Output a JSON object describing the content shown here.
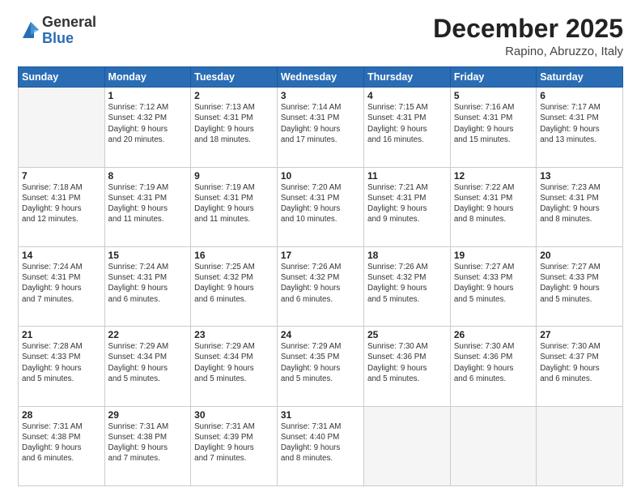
{
  "header": {
    "logo_general": "General",
    "logo_blue": "Blue",
    "month_title": "December 2025",
    "location": "Rapino, Abruzzo, Italy"
  },
  "weekdays": [
    "Sunday",
    "Monday",
    "Tuesday",
    "Wednesday",
    "Thursday",
    "Friday",
    "Saturday"
  ],
  "weeks": [
    [
      {
        "day": "",
        "info": ""
      },
      {
        "day": "1",
        "info": "Sunrise: 7:12 AM\nSunset: 4:32 PM\nDaylight: 9 hours\nand 20 minutes."
      },
      {
        "day": "2",
        "info": "Sunrise: 7:13 AM\nSunset: 4:31 PM\nDaylight: 9 hours\nand 18 minutes."
      },
      {
        "day": "3",
        "info": "Sunrise: 7:14 AM\nSunset: 4:31 PM\nDaylight: 9 hours\nand 17 minutes."
      },
      {
        "day": "4",
        "info": "Sunrise: 7:15 AM\nSunset: 4:31 PM\nDaylight: 9 hours\nand 16 minutes."
      },
      {
        "day": "5",
        "info": "Sunrise: 7:16 AM\nSunset: 4:31 PM\nDaylight: 9 hours\nand 15 minutes."
      },
      {
        "day": "6",
        "info": "Sunrise: 7:17 AM\nSunset: 4:31 PM\nDaylight: 9 hours\nand 13 minutes."
      }
    ],
    [
      {
        "day": "7",
        "info": "Sunrise: 7:18 AM\nSunset: 4:31 PM\nDaylight: 9 hours\nand 12 minutes."
      },
      {
        "day": "8",
        "info": "Sunrise: 7:19 AM\nSunset: 4:31 PM\nDaylight: 9 hours\nand 11 minutes."
      },
      {
        "day": "9",
        "info": "Sunrise: 7:19 AM\nSunset: 4:31 PM\nDaylight: 9 hours\nand 11 minutes."
      },
      {
        "day": "10",
        "info": "Sunrise: 7:20 AM\nSunset: 4:31 PM\nDaylight: 9 hours\nand 10 minutes."
      },
      {
        "day": "11",
        "info": "Sunrise: 7:21 AM\nSunset: 4:31 PM\nDaylight: 9 hours\nand 9 minutes."
      },
      {
        "day": "12",
        "info": "Sunrise: 7:22 AM\nSunset: 4:31 PM\nDaylight: 9 hours\nand 8 minutes."
      },
      {
        "day": "13",
        "info": "Sunrise: 7:23 AM\nSunset: 4:31 PM\nDaylight: 9 hours\nand 8 minutes."
      }
    ],
    [
      {
        "day": "14",
        "info": "Sunrise: 7:24 AM\nSunset: 4:31 PM\nDaylight: 9 hours\nand 7 minutes."
      },
      {
        "day": "15",
        "info": "Sunrise: 7:24 AM\nSunset: 4:31 PM\nDaylight: 9 hours\nand 6 minutes."
      },
      {
        "day": "16",
        "info": "Sunrise: 7:25 AM\nSunset: 4:32 PM\nDaylight: 9 hours\nand 6 minutes."
      },
      {
        "day": "17",
        "info": "Sunrise: 7:26 AM\nSunset: 4:32 PM\nDaylight: 9 hours\nand 6 minutes."
      },
      {
        "day": "18",
        "info": "Sunrise: 7:26 AM\nSunset: 4:32 PM\nDaylight: 9 hours\nand 5 minutes."
      },
      {
        "day": "19",
        "info": "Sunrise: 7:27 AM\nSunset: 4:33 PM\nDaylight: 9 hours\nand 5 minutes."
      },
      {
        "day": "20",
        "info": "Sunrise: 7:27 AM\nSunset: 4:33 PM\nDaylight: 9 hours\nand 5 minutes."
      }
    ],
    [
      {
        "day": "21",
        "info": "Sunrise: 7:28 AM\nSunset: 4:33 PM\nDaylight: 9 hours\nand 5 minutes."
      },
      {
        "day": "22",
        "info": "Sunrise: 7:29 AM\nSunset: 4:34 PM\nDaylight: 9 hours\nand 5 minutes."
      },
      {
        "day": "23",
        "info": "Sunrise: 7:29 AM\nSunset: 4:34 PM\nDaylight: 9 hours\nand 5 minutes."
      },
      {
        "day": "24",
        "info": "Sunrise: 7:29 AM\nSunset: 4:35 PM\nDaylight: 9 hours\nand 5 minutes."
      },
      {
        "day": "25",
        "info": "Sunrise: 7:30 AM\nSunset: 4:36 PM\nDaylight: 9 hours\nand 5 minutes."
      },
      {
        "day": "26",
        "info": "Sunrise: 7:30 AM\nSunset: 4:36 PM\nDaylight: 9 hours\nand 6 minutes."
      },
      {
        "day": "27",
        "info": "Sunrise: 7:30 AM\nSunset: 4:37 PM\nDaylight: 9 hours\nand 6 minutes."
      }
    ],
    [
      {
        "day": "28",
        "info": "Sunrise: 7:31 AM\nSunset: 4:38 PM\nDaylight: 9 hours\nand 6 minutes."
      },
      {
        "day": "29",
        "info": "Sunrise: 7:31 AM\nSunset: 4:38 PM\nDaylight: 9 hours\nand 7 minutes."
      },
      {
        "day": "30",
        "info": "Sunrise: 7:31 AM\nSunset: 4:39 PM\nDaylight: 9 hours\nand 7 minutes."
      },
      {
        "day": "31",
        "info": "Sunrise: 7:31 AM\nSunset: 4:40 PM\nDaylight: 9 hours\nand 8 minutes."
      },
      {
        "day": "",
        "info": ""
      },
      {
        "day": "",
        "info": ""
      },
      {
        "day": "",
        "info": ""
      }
    ]
  ]
}
